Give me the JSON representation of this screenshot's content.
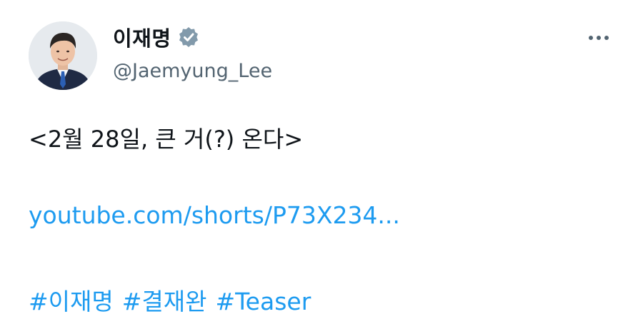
{
  "tweet": {
    "author": {
      "display_name": "이재명",
      "handle": "@Jaemyung_Lee",
      "verified_icon": "verified-badge-icon",
      "avatar": "profile-photo"
    },
    "more_icon": "more-options-icon",
    "text_line": "<2월 28일, 큰 거(?) 온다>",
    "link": "youtube.com/shorts/P73X234...",
    "hashtags": [
      "#이재명",
      "#결재완",
      "#Teaser"
    ]
  },
  "colors": {
    "text": "#0f1419",
    "secondary": "#536471",
    "link": "#1d9bf0",
    "verified_badge": "#829aab"
  }
}
